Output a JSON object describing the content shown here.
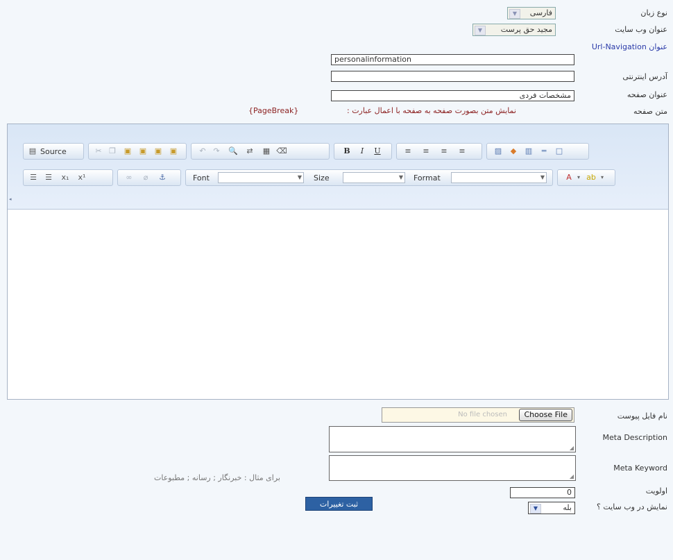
{
  "form": {
    "language": {
      "label": "نوع زبان",
      "value": "فارسی"
    },
    "website_title": {
      "label": "عنوان وب سایت",
      "value": "مجید حق پرست"
    },
    "url_navigation": {
      "label": "عنوان Url-Navigation",
      "value": "personalinformation"
    },
    "web_address": {
      "label": "آدرس اینترنتی",
      "value": ""
    },
    "page_title": {
      "label": "عنوان صفحه",
      "value": "مشخصات فردی"
    },
    "page_text": {
      "label": "متن صفحه",
      "hint": "نمایش متن بصورت صفحه به صفحه با اعمال عبارت :",
      "pagebreak_token": "{PageBreak}"
    },
    "attachment": {
      "label": "نام فایل پیوست",
      "button": "Choose File",
      "status": "No file chosen"
    },
    "meta_description": {
      "label": "Meta Description",
      "value": ""
    },
    "meta_keyword": {
      "label": "Meta Keyword",
      "value": "",
      "example": "برای مثال : خبرنگار ; رسانه ; مطبوعات"
    },
    "priority": {
      "label": "اولویت",
      "value": "0"
    },
    "show_on_site": {
      "label": "نمایش در وب سایت ؟",
      "value": "بله"
    },
    "submit_label": "ثبت تغییرات"
  },
  "editor_toolbar": {
    "source_label": "Source",
    "font_label": "Font",
    "size_label": "Size",
    "format_label": "Format",
    "bold": "B",
    "italic": "I",
    "underline": "U"
  },
  "colors": {
    "submit_bg": "#2d61a3",
    "label_blue": "#2a3aa8",
    "hint_red": "#8b1f1f"
  }
}
